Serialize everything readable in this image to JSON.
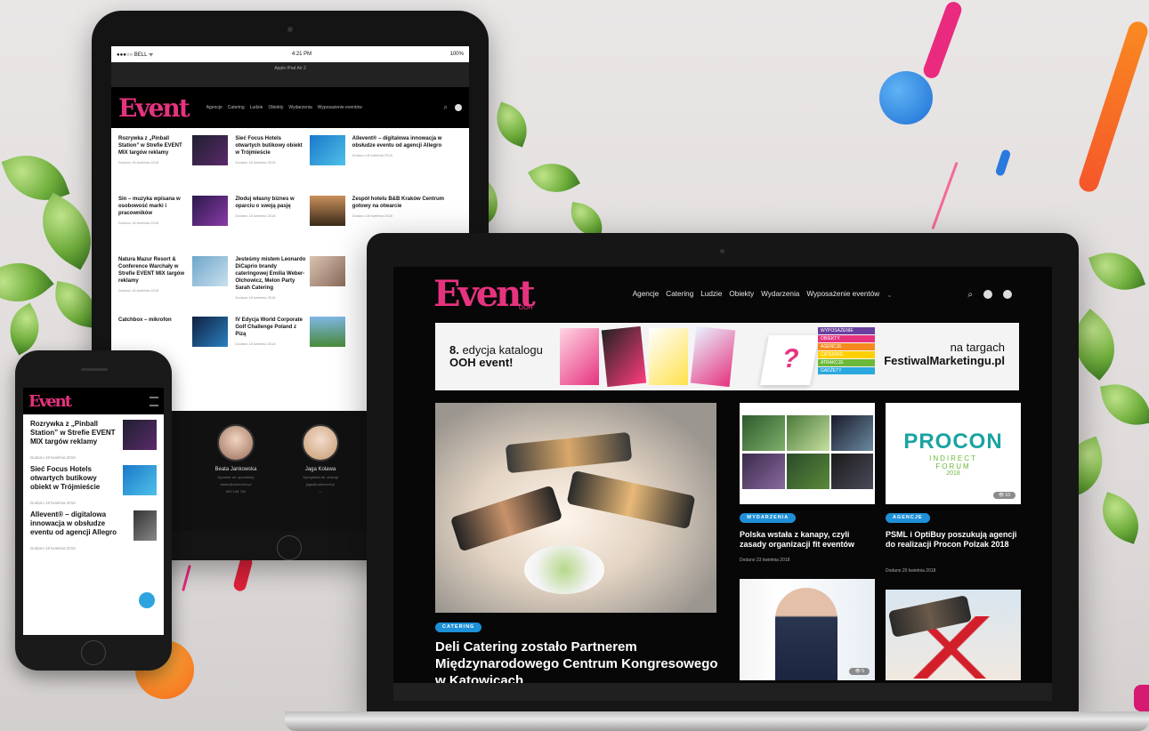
{
  "tablet": {
    "status": {
      "carrier": "●●●○○ BELL ᯤ",
      "time": "4:21 PM",
      "battery": "100%"
    },
    "url": "Apple iPad Air 2",
    "logo": "Event",
    "nav": [
      "Agencje",
      "Catering",
      "Ludzie",
      "Obiekty",
      "Wydarzenia",
      "Wyposażenie eventów"
    ],
    "articles": [
      {
        "title": "Rozrywka z „Pinball Station” w Strefie EVENT MIX targów reklamy",
        "date": "Dodano 18 kwietnia 2018"
      },
      {
        "title": "Sieć Focus Hotels otwartych butikowy obiekt w Trójmieście",
        "date": "Dodano 18 kwietnia 2018"
      },
      {
        "title": "Allevent® – digitalowa innowacja w obsłudze eventu od agencji Allegro",
        "date": "Dodano 18 kwietnia 2018"
      },
      {
        "title": "Sin – muzyka wpisana w osobowość marki i pracowników",
        "date": "Dodano 18 kwietnia 2018"
      },
      {
        "title": "Złoduj własny biznes w oparciu o swoją pasję",
        "date": "Dodano 18 kwietnia 2018"
      },
      {
        "title": "Zespół hotelu B&B Kraków Centrum gotowy na otwarcie",
        "date": "Dodano 18 kwietnia 2018"
      },
      {
        "title": "Natura Mazur Resort & Conference Warchały w Strefie EVENT MIX targów reklamy",
        "date": "Dodano 18 kwietnia 2018"
      },
      {
        "title": "Jesteśmy mistem Leonardo DiCaprio brandy cateringowej Emilia Weber-Olchowicz, Melon Party Sarah Catering",
        "date": "Dodano 18 kwietnia 2018"
      },
      {
        "title": "",
        "date": ""
      },
      {
        "title": "Catchbox – mikrofon",
        "date": ""
      },
      {
        "title": "IV Edycja World Corporate Golf Challenge Poland z Pizą",
        "date": "Dodano 18 kwietnia 2018"
      },
      {
        "title": "",
        "date": ""
      }
    ],
    "people": [
      {
        "name": "Beata Jankowska",
        "role": "Dyrektor ds. sprzedaży",
        "email": "beata@oohevent.pl",
        "phone": "600 148 754"
      },
      {
        "name": "Jaga Kolawa",
        "role": "Specjalista ds. obsługi",
        "email": "jaga@oohevent.pl",
        "phone": "---"
      }
    ]
  },
  "phone": {
    "logo": "Event",
    "articles": [
      {
        "title": "Rozrywka z „Pinball Station” w Strefie EVENT MIX targów reklamy",
        "date": "Dodano 18 kwietnia 2018"
      },
      {
        "title": "Sieć Focus Hotels otwartych butikowy obiekt w Trójmieście",
        "date": "Dodano 18 kwietnia 2018"
      },
      {
        "title": "Allevent® – digitalowa innowacja w obsłudze eventu od agencji Allegro",
        "date": "Dodano 18 kwietnia 2018"
      }
    ]
  },
  "laptop": {
    "logo": "Event",
    "logo_sub": "OOH",
    "nav": [
      "Agencje",
      "Catering",
      "Ludzie",
      "Obiekty",
      "Wydarzenia",
      "Wyposażenie eventów"
    ],
    "nav_chevron": "⌄",
    "banner": {
      "left_num": "8.",
      "left_1": " edycja katalogu",
      "left_2": "OOH event!",
      "right_1": "na targach",
      "right_2": "FestiwalMarketingu.pl",
      "question": "?",
      "badges": [
        "WYPOSAŻENIE",
        "OBIEKTY",
        "AGENCJE",
        "CATERING",
        "ATRAKCJE",
        "GADŻETY"
      ]
    },
    "main": {
      "tag": "CATERING",
      "title": "Deli Catering zostało Partnerem Międzynarodowego Centrum Kongresowego w Katowicach"
    },
    "cards": [
      {
        "tag": "WYDARZENIA",
        "title": "Polska wstała z kanapy, czyli zasady organizacji fit eventów",
        "date": "Dodano 23 kwietnia 2018",
        "views": ""
      },
      {
        "tag": "AGENCJE",
        "title": "PSML i OptiBuy poszukują agencji do realizacji Procon Polzak 2018",
        "date": "Dodano 20 kwietnia 2018",
        "views": "👁 10"
      },
      {
        "views": "👁 5"
      },
      {
        "views": ""
      }
    ],
    "procon": {
      "title": "PROCON",
      "line1": "INDIRECT",
      "line2": "FORUM",
      "year": "2018"
    }
  }
}
